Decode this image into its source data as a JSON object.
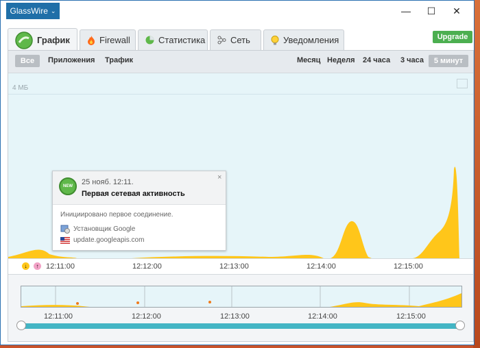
{
  "app": {
    "title": "GlassWire",
    "menu_icon": "chevron-down-icon"
  },
  "window_controls": {
    "minimize": "—",
    "maximize": "☐",
    "close": "✕"
  },
  "tabs": [
    {
      "label": "График",
      "icon": "glasswire-graph-icon",
      "active": true
    },
    {
      "label": "Firewall",
      "icon": "fire-icon",
      "active": false
    },
    {
      "label": "Статистика",
      "icon": "pie-icon",
      "active": false
    },
    {
      "label": "Сеть",
      "icon": "network-icon",
      "active": false
    },
    {
      "label": "Уведомления",
      "icon": "bulb-icon",
      "active": false
    }
  ],
  "upgrade_label": "Upgrade",
  "filters": {
    "all": "Все",
    "apps": "Приложения",
    "traffic": "Трафик"
  },
  "ranges": [
    "Месяц",
    "Неделя",
    "24 часа",
    "3 часа",
    "5 минут"
  ],
  "selected_range": "5 минут",
  "chart": {
    "scale_label": "4 МБ",
    "time_labels": [
      "12:11:00",
      "12:12:00",
      "12:13:00",
      "12:14:00",
      "12:15:00"
    ]
  },
  "tooltip": {
    "badge": "NEW",
    "date": "25 нояб. 12:11.",
    "title": "Первая сетевая активность",
    "desc": "Инициировано первое соединение.",
    "app": "Установщик Google",
    "host": "update.googleapis.com",
    "close": "×"
  },
  "mini_time_labels": [
    "12:11:00",
    "12:12:00",
    "12:13:00",
    "12:14:00",
    "12:15:00"
  ],
  "colors": {
    "traffic": "#ffc61a",
    "accent": "#1f6fa8",
    "upgrade": "#4caf50"
  }
}
